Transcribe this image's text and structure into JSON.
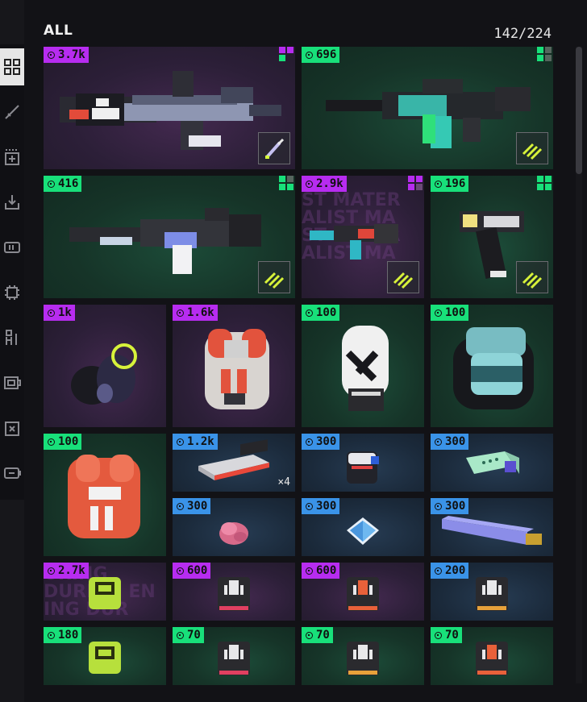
{
  "header": {
    "title": "ALL",
    "count": "142/224"
  },
  "sidebar": {
    "items": [
      {
        "icon": "grid-icon",
        "active": true
      },
      {
        "icon": "rifle-icon"
      },
      {
        "icon": "add-slot-icon"
      },
      {
        "icon": "inbox-download-icon"
      },
      {
        "icon": "ammo-box-icon"
      },
      {
        "icon": "chip-icon"
      },
      {
        "icon": "armor-icon"
      },
      {
        "icon": "device-icon"
      },
      {
        "icon": "discard-icon"
      },
      {
        "icon": "battery-icon"
      }
    ]
  },
  "colors": {
    "purple": "#b72cf0",
    "green": "#18e07a",
    "blue": "#3a93e8"
  },
  "watermark": {
    "card5": [
      "ST MATER",
      "ALIST MA",
      "ST MATER",
      "ALIST MA"
    ],
    "card16": [
      "URING",
      "DURING EN",
      "ING DUR"
    ]
  },
  "items": [
    {
      "name": "long-rifle",
      "price": "3.7k",
      "rarity": "purple",
      "ammo": true
    },
    {
      "name": "smg-teal",
      "price": "696",
      "rarity": "green",
      "ammo": true
    },
    {
      "name": "railgun",
      "price": "416",
      "rarity": "green",
      "ammo": true
    },
    {
      "name": "teal-carbine",
      "price": "2.9k",
      "rarity": "purple",
      "ammo": true
    },
    {
      "name": "pistol",
      "price": "196",
      "rarity": "green",
      "ammo": true
    },
    {
      "name": "gloves",
      "price": "1k",
      "rarity": "purple"
    },
    {
      "name": "chest-armor-red",
      "price": "1.6k",
      "rarity": "purple"
    },
    {
      "name": "white-helmet",
      "price": "100",
      "rarity": "green"
    },
    {
      "name": "teal-helmet",
      "price": "100",
      "rarity": "green"
    },
    {
      "name": "med-vest",
      "price": "100",
      "rarity": "green"
    },
    {
      "name": "battery-cell",
      "price": "1.2k",
      "rarity": "blue",
      "qty": "×4"
    },
    {
      "name": "canister",
      "price": "300",
      "rarity": "blue"
    },
    {
      "name": "mint-module",
      "price": "300",
      "rarity": "blue"
    },
    {
      "name": "pink-organ",
      "price": "300",
      "rarity": "blue"
    },
    {
      "name": "blue-crystal",
      "price": "300",
      "rarity": "blue"
    },
    {
      "name": "purple-barrel",
      "price": "300",
      "rarity": "blue"
    },
    {
      "name": "chip-green-04",
      "price": "2.7k",
      "rarity": "purple"
    },
    {
      "name": "chip-01",
      "price": "600",
      "rarity": "purple"
    },
    {
      "name": "chip-02",
      "price": "600",
      "rarity": "purple"
    },
    {
      "name": "chip-03",
      "price": "200",
      "rarity": "blue"
    },
    {
      "name": "chip-green-04b",
      "price": "180",
      "rarity": "green"
    },
    {
      "name": "chip-01b",
      "price": "70",
      "rarity": "green"
    },
    {
      "name": "chip-03b",
      "price": "70",
      "rarity": "green"
    },
    {
      "name": "chip-02b",
      "price": "70",
      "rarity": "green"
    }
  ]
}
